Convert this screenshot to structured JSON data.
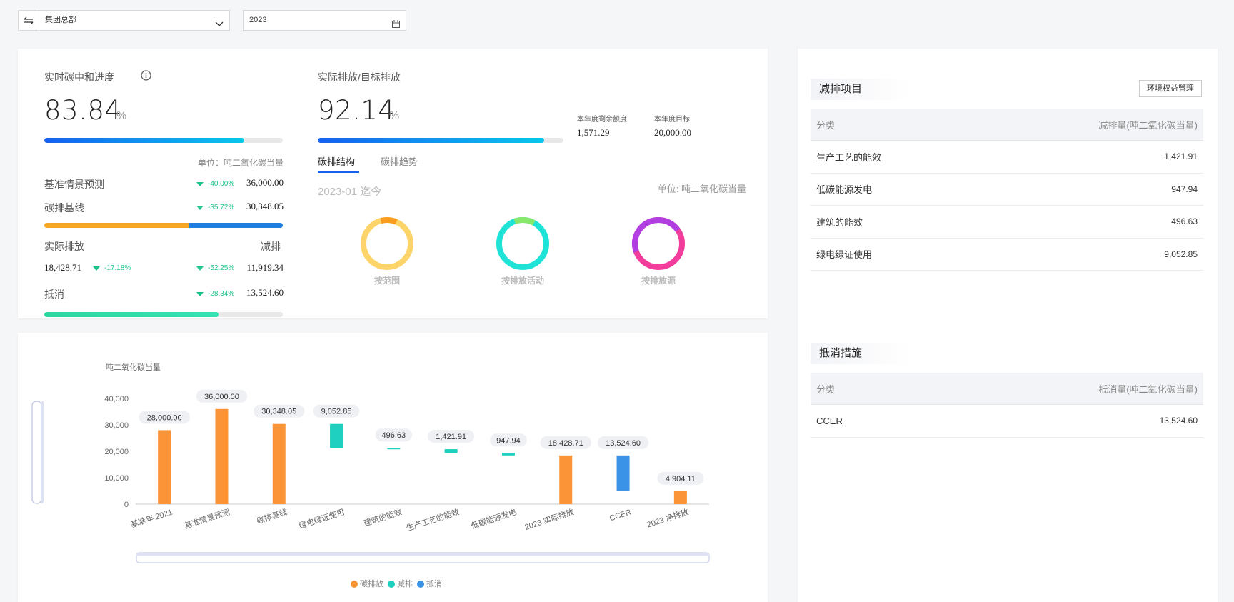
{
  "toolbar": {
    "org_selected": "集团总部",
    "year_selected": "2023"
  },
  "progress": {
    "title": "实时碳中和进度",
    "value": "83.84",
    "unit": "%",
    "bar_fraction": 0.8384,
    "unit_label": "单位：吨二氧化碳当量",
    "baseline_forecast": {
      "label": "基准情景预测",
      "pct": "-40.00%",
      "value": "36,000.00"
    },
    "carbon_baseline": {
      "label": "碳排基线",
      "pct": "-35.72%",
      "value": "30,348.05"
    },
    "actual": {
      "label": "实际排放",
      "value": "18,428.71",
      "pct": "-17.18%"
    },
    "reduction": {
      "label": "减排",
      "pct": "-52.25%",
      "value": "11,919.34"
    },
    "offset": {
      "label": "抵消",
      "pct": "-28.34%",
      "value": "13,524.60",
      "bar_fraction": 0.73
    }
  },
  "target": {
    "title": "实际排放/目标排放",
    "value": "92.14",
    "unit": "%",
    "bar_fraction": 0.9214,
    "remaining_label": "本年度剩余额度",
    "remaining_value": "1,571.29",
    "goal_label": "本年度目标",
    "goal_value": "20,000.00",
    "tabs": [
      "碳排结构",
      "碳排趋势"
    ],
    "period": "2023-01 迄今",
    "unit_label": "单位: 吨二氧化碳当量",
    "donuts": [
      {
        "label": "按范围"
      },
      {
        "label": "按排放活动"
      },
      {
        "label": "按排放源"
      }
    ]
  },
  "reduction_projects": {
    "title": "减排项目",
    "manage_button": "环境权益管理",
    "col_category": "分类",
    "col_amount": "减排量(吨二氧化碳当量)",
    "rows": [
      {
        "name": "生产工艺的能效",
        "value": "1,421.91"
      },
      {
        "name": "低碳能源发电",
        "value": "947.94"
      },
      {
        "name": "建筑的能效",
        "value": "496.63"
      },
      {
        "name": "绿电绿证使用",
        "value": "9,052.85"
      }
    ]
  },
  "offset_measures": {
    "title": "抵消措施",
    "col_category": "分类",
    "col_amount": "抵消量(吨二氧化碳当量)",
    "rows": [
      {
        "name": "CCER",
        "value": "13,524.60"
      }
    ]
  },
  "colors": {
    "emission": "#fa9436",
    "reduction": "#1fcfc0",
    "offset": "#3a93e6",
    "accent": "#1a5ff0"
  },
  "chart_data": {
    "type": "bar",
    "ylabel": "吨二氧化碳当量",
    "ylim": [
      0,
      40000
    ],
    "yticks": [
      "0",
      "10,000",
      "20,000",
      "30,000",
      "40,000"
    ],
    "legend_position": "bottom",
    "legend": [
      {
        "name": "碳排放",
        "color": "#fa9436"
      },
      {
        "name": "减排",
        "color": "#1fcfc0"
      },
      {
        "name": "抵消",
        "color": "#3a93e6"
      }
    ],
    "bars": [
      {
        "category": "基准年 2021",
        "start": 0,
        "end": 28000,
        "label": "28,000.00",
        "kind": "emission"
      },
      {
        "category": "基准情景预测",
        "start": 0,
        "end": 36000,
        "label": "36,000.00",
        "kind": "emission"
      },
      {
        "category": "碳排基线",
        "start": 0,
        "end": 30348.05,
        "label": "30,348.05",
        "kind": "emission"
      },
      {
        "category": "绿电绿证使用",
        "start": 21295.2,
        "end": 30348.05,
        "label": "9,052.85",
        "kind": "reduction"
      },
      {
        "category": "建筑的能效",
        "start": 20798.57,
        "end": 21295.2,
        "label": "496.63",
        "kind": "reduction"
      },
      {
        "category": "生产工艺的能效",
        "start": 19376.66,
        "end": 20798.57,
        "label": "1,421.91",
        "kind": "reduction"
      },
      {
        "category": "低碳能源发电",
        "start": 18428.72,
        "end": 19376.66,
        "label": "947.94",
        "kind": "reduction"
      },
      {
        "category": "2023 实际排放",
        "start": 0,
        "end": 18428.71,
        "label": "18,428.71",
        "kind": "emission"
      },
      {
        "category": "CCER",
        "start": 4904.11,
        "end": 18428.71,
        "label": "13,524.60",
        "kind": "offset"
      },
      {
        "category": "2023 净排放",
        "start": 0,
        "end": 4904.11,
        "label": "4,904.11",
        "kind": "emission"
      }
    ]
  }
}
